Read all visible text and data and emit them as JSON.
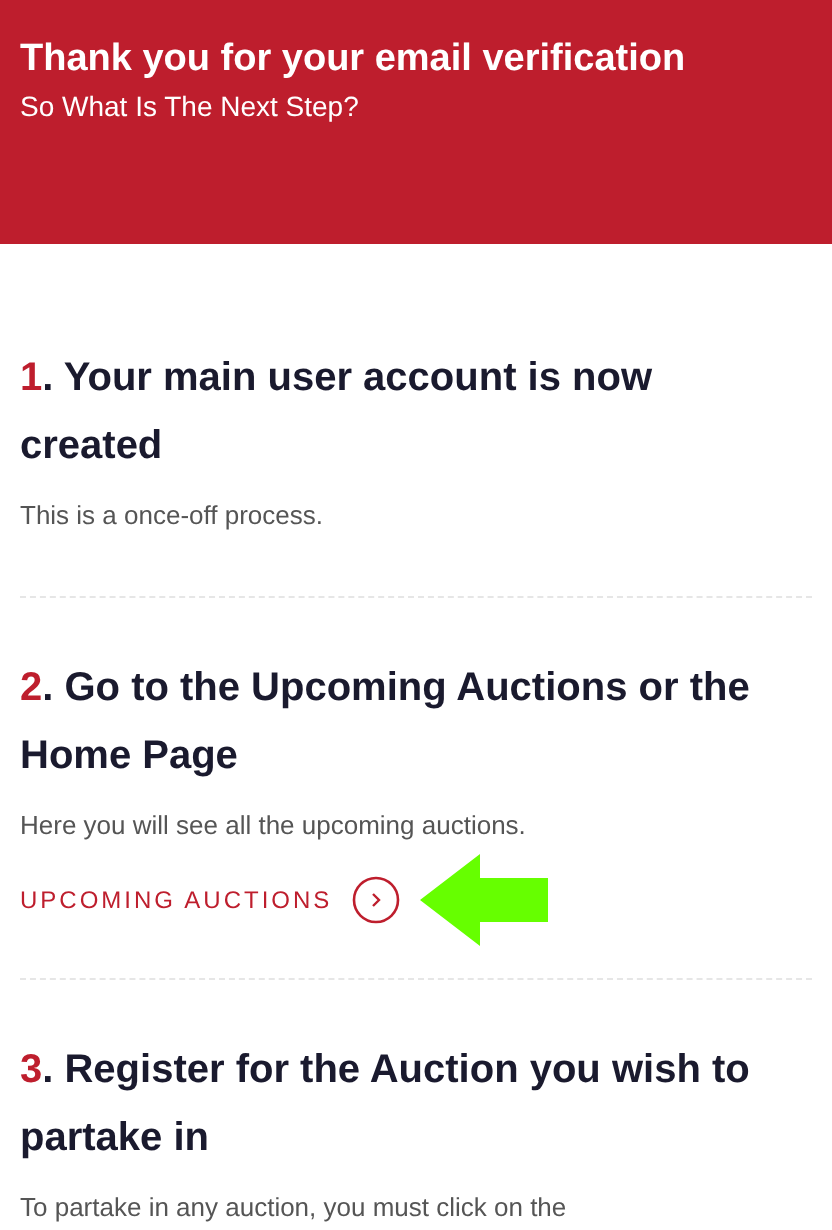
{
  "header": {
    "title": "Thank you for your email verification",
    "subtitle": "So What Is The Next Step?"
  },
  "steps": [
    {
      "number": "1",
      "title": ". Your main user account is now created",
      "description": "This is a once-off process."
    },
    {
      "number": "2",
      "title": ". Go to the Upcoming Auctions or the Home Page",
      "description": "Here you will see all the upcoming auctions.",
      "link": "UPCOMING AUCTIONS"
    },
    {
      "number": "3",
      "title": ". Register for the Auction you wish to partake in",
      "description": "To partake in any auction, you must click on the"
    }
  ]
}
